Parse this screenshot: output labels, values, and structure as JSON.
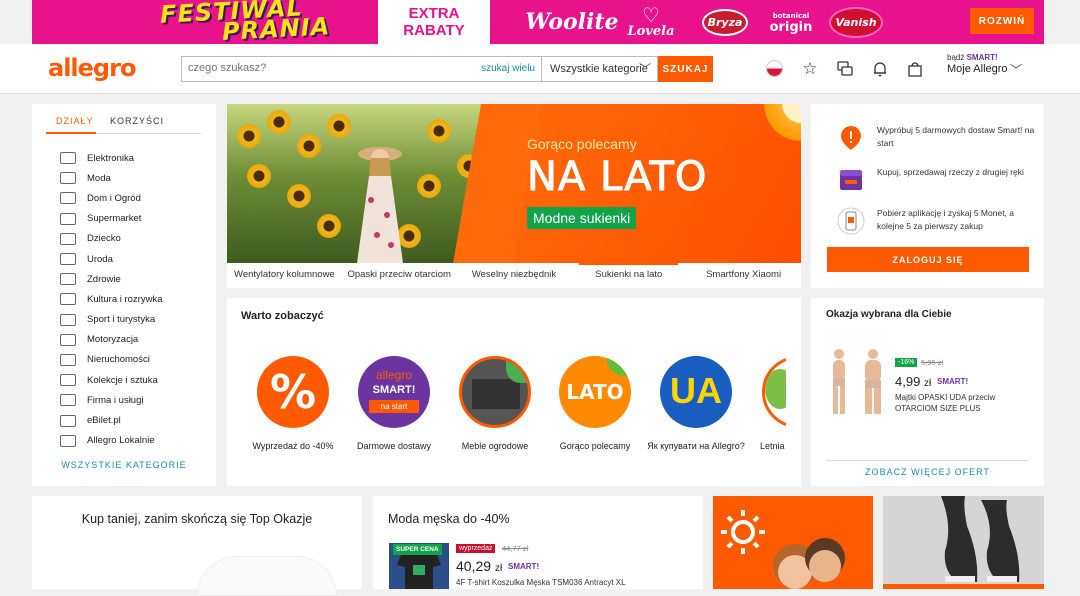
{
  "promo": {
    "festiwal": "FESTIWAL",
    "prania": "PRANIA",
    "extra_line1": "EXTRA",
    "extra_line2": "RABATY",
    "brands": [
      "Woolite",
      "Lovela",
      "Bryza",
      "botanical origin",
      "Vanish"
    ],
    "lovela_sub": "baby",
    "botanical_small": "botanical",
    "botanical_big": "origin",
    "cta": "ROZWIŃ"
  },
  "header": {
    "logo": "allegro",
    "search_placeholder": "czego szukasz?",
    "search_many": "szukaj wielu",
    "category_select": "Wszystkie kategorie",
    "search_button": "SZUKAJ",
    "smart_prefix": "bądź",
    "smart_label": "SMART!",
    "account": "Moje Allegro"
  },
  "sidebar": {
    "tabs": [
      "DZIAŁY",
      "KORZYŚCI"
    ],
    "items": [
      "Elektronika",
      "Moda",
      "Dom i Ogród",
      "Supermarket",
      "Dziecko",
      "Uroda",
      "Zdrowie",
      "Kultura i rozrywka",
      "Sport i turystyka",
      "Motoryzacja",
      "Nieruchomości",
      "Kolekcje i sztuka",
      "Firma i usługi",
      "eBilet.pl",
      "Allegro Lokalnie"
    ],
    "all_link": "WSZYSTKIE KATEGORIE"
  },
  "hero": {
    "subtitle": "Gorąco polecamy",
    "title": "NA LATO",
    "tag": "Modne sukienki",
    "links": [
      "Wentylatory kolumnowe",
      "Opaski przeciw otarciom",
      "Weselny niezbędnik",
      "Sukienki na lato",
      "Smartfony Xiaomi"
    ],
    "active_link": 3
  },
  "right_panel": {
    "rows": [
      "Wypróbuj 5 darmowych dostaw Smart! na start",
      "Kupuj, sprzedawaj rzeczy z drugiej ręki",
      "Pobierz aplikację i zyskaj 5 Monet, a kolejne 5 za pierwszy zakup"
    ],
    "login": "ZALOGUJ SIĘ"
  },
  "warto": {
    "title": "Warto zobaczyć",
    "items": [
      {
        "label": "Wyprzedaż do -40%"
      },
      {
        "label": "Darmowe dostawy"
      },
      {
        "label": "Meble ogrodowe"
      },
      {
        "label": "Gorąco polecamy"
      },
      {
        "label": "Як купувати на Allegro?"
      },
      {
        "label": "Letnia"
      }
    ],
    "icon_percent": "%",
    "smart_word1": "allegro",
    "smart_word2": "SMART!",
    "smart_word3": "na start",
    "lato_word": "LATO",
    "ua_word": "UA"
  },
  "okazja": {
    "title": "Okazja wybrana dla Ciebie",
    "discount": "-16%",
    "old_price": "5,95 zł",
    "price_main": "4,99",
    "price_cur": "zł",
    "smart": "SMART!",
    "name": "Majtki OPASKI UDA przeciw OTARCIOM SIZE PLUS",
    "more": "ZOBACZ WIĘCEJ OFERT"
  },
  "bottom": {
    "top_okazje_title": "Kup taniej, zanim skończą się Top Okazje",
    "moda_title": "Moda męska do -40%",
    "moda_super": "SUPER CENA",
    "moda_promo": "wyprzedaż",
    "moda_old": "44,77 zł",
    "moda_price": "40,29",
    "moda_cur": "zł",
    "moda_smart": "SMART!",
    "moda_name": "4F T-shirt Koszulka Męska TSM036 Antracyt XL"
  },
  "colors": {
    "accent": "#ff5a00",
    "promo_bg": "#e8128d",
    "link": "#1a8fa0",
    "green": "#13a34a",
    "smart_purple": "#6b34a0"
  }
}
